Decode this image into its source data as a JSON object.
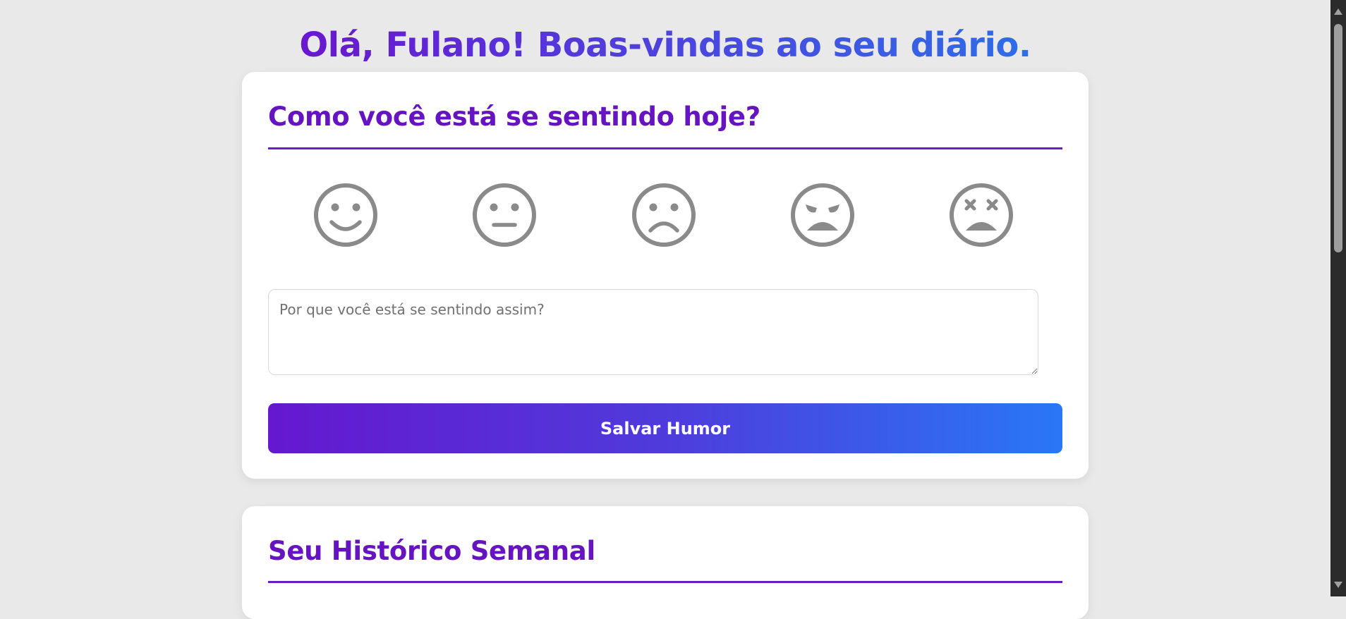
{
  "header": {
    "welcome": "Olá, Fulano! Boas-vindas ao seu diário."
  },
  "mood_card": {
    "title": "Como você está se sentindo hoje?",
    "moods": [
      {
        "icon": "happy-face-icon"
      },
      {
        "icon": "neutral-face-icon"
      },
      {
        "icon": "sad-face-icon"
      },
      {
        "icon": "angry-face-icon"
      },
      {
        "icon": "exhausted-face-icon"
      }
    ],
    "reason_placeholder": "Por que você está se sentindo assim?",
    "reason_value": "",
    "save_label": "Salvar Humor"
  },
  "history_card": {
    "title": "Seu Histórico Semanal"
  },
  "colors": {
    "accent": "#6614c2",
    "gradient_start": "#6518cf",
    "gradient_end": "#2977f7",
    "icon_gray": "#8a8a8a",
    "background": "#e9e9ea"
  }
}
